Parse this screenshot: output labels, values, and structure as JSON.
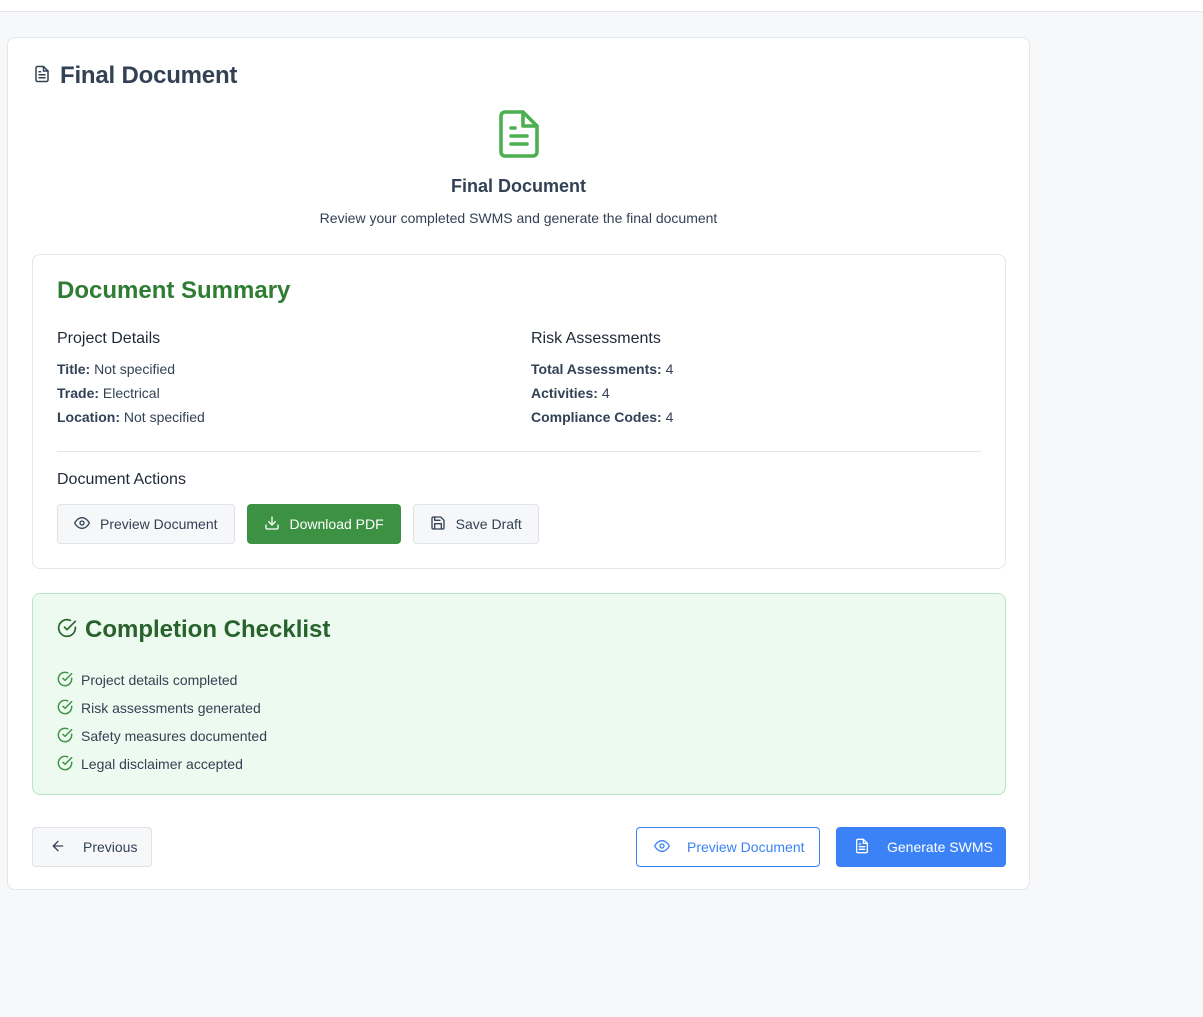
{
  "header": {
    "title": "Final Document",
    "icon": "file-text-icon"
  },
  "hero": {
    "icon": "file-text-icon",
    "title": "Final Document",
    "subtitle": "Review your completed SWMS and generate the final document"
  },
  "summary": {
    "title": "Document Summary",
    "project": {
      "heading": "Project Details",
      "rows": [
        {
          "label": "Title:",
          "value": "Not specified"
        },
        {
          "label": "Trade:",
          "value": "Electrical"
        },
        {
          "label": "Location:",
          "value": "Not specified"
        }
      ]
    },
    "risk": {
      "heading": "Risk Assessments",
      "rows": [
        {
          "label": "Total Assessments:",
          "value": "4"
        },
        {
          "label": "Activities:",
          "value": "4"
        },
        {
          "label": "Compliance Codes:",
          "value": "4"
        }
      ]
    },
    "actions": {
      "heading": "Document Actions",
      "preview_label": "Preview Document",
      "download_label": "Download PDF",
      "save_label": "Save Draft"
    }
  },
  "checklist": {
    "title": "Completion Checklist",
    "items": [
      "Project details completed",
      "Risk assessments generated",
      "Safety measures documented",
      "Legal disclaimer accepted"
    ]
  },
  "footer": {
    "previous_label": "Previous",
    "preview_label": "Preview Document",
    "generate_label": "Generate SWMS"
  },
  "colors": {
    "accent_green": "#2e7d32",
    "button_green": "#3d9142",
    "accent_blue": "#3b82f6",
    "checklist_bg": "#edfaef"
  }
}
